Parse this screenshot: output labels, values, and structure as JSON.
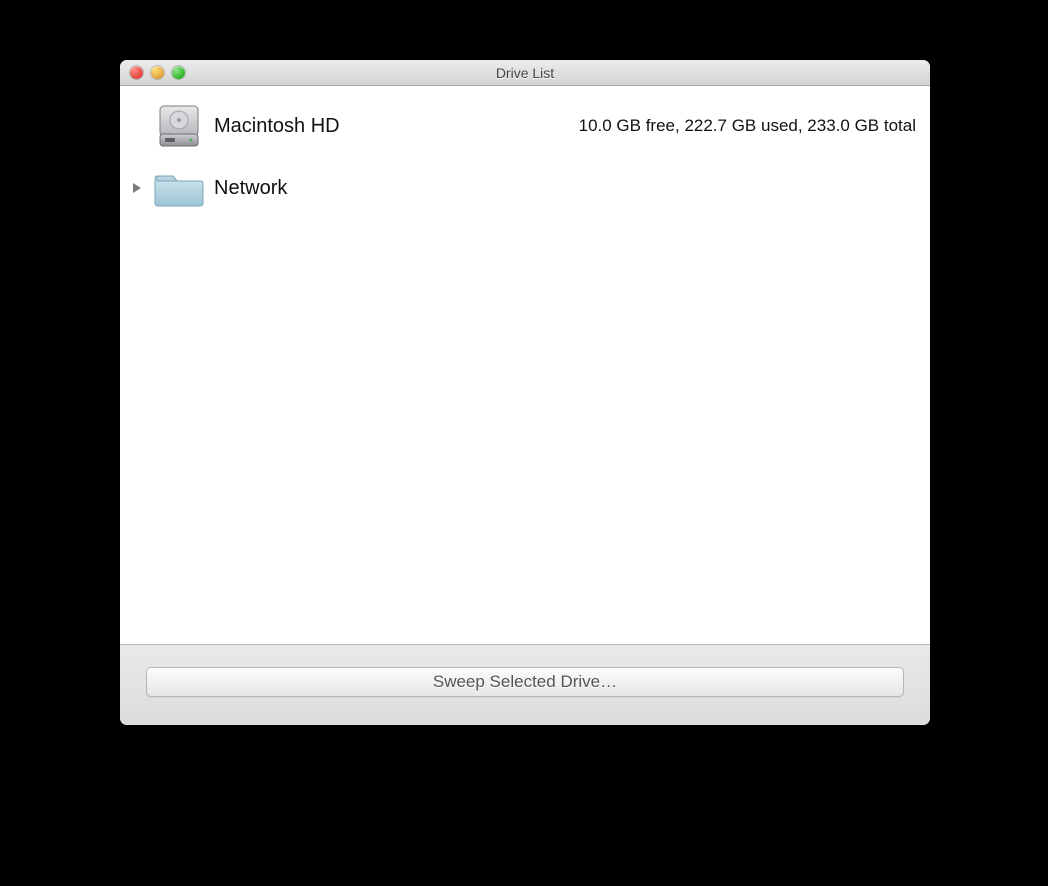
{
  "window": {
    "title": "Drive List"
  },
  "drives": [
    {
      "name": "Macintosh HD",
      "stats": "10.0 GB free, 222.7 GB used, 233.0 GB total"
    },
    {
      "name": "Network",
      "stats": ""
    }
  ],
  "footer": {
    "sweep_label": "Sweep Selected Drive…"
  }
}
